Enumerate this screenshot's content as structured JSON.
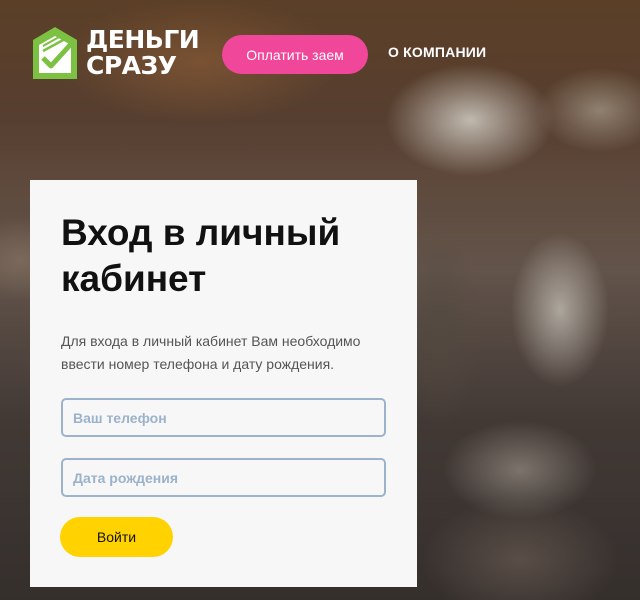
{
  "header": {
    "logo": {
      "line1": "ДЕНЬГИ",
      "line2": "СРАЗУ",
      "icon": "wallet-check-icon"
    },
    "pay_button_label": "Оплатить заем",
    "nav_about_label": "О КОМПАНИИ"
  },
  "login": {
    "title": "Вход в личный кабинет",
    "description": "Для входа в личный кабинет Вам необходимо ввести номер телефона и дату рождения.",
    "phone": {
      "value": "",
      "placeholder": "Ваш телефон"
    },
    "birthdate": {
      "value": "",
      "placeholder": "Дата рождения"
    },
    "submit_label": "Войти"
  },
  "colors": {
    "brand_green": "#7cc142",
    "pay_button": "#f0479a",
    "login_button": "#ffd200",
    "field_border": "#9db3cc"
  }
}
